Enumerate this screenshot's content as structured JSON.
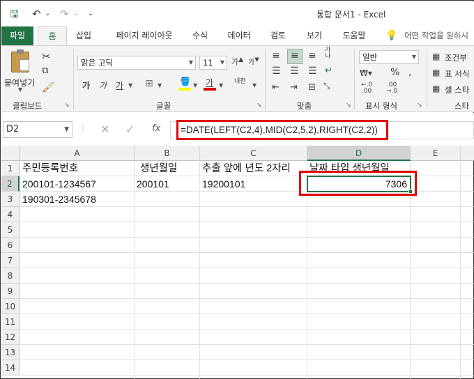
{
  "window": {
    "title": "통합 문서1  -  Excel"
  },
  "qat": {
    "save": "🖫",
    "undo": "↶",
    "redo": "↷",
    "more": "⌄"
  },
  "tabs": [
    "파일",
    "홈",
    "삽입",
    "페이지 레이아웃",
    "수식",
    "데이터",
    "검토",
    "보기",
    "도움말"
  ],
  "tell_me": "어떤 작업을 원하시",
  "ribbon": {
    "paste": "붙여넣기",
    "groups": {
      "clipboard": "클립보드",
      "font": "글꼴",
      "align": "맞춤",
      "number": "표시 형식",
      "styles": "스타"
    },
    "font_name": "맑은 고딕",
    "font_size": "11",
    "number_format": "일반",
    "cond_format": "조건부",
    "table_format": "표 서식",
    "cell_style": "셀 스타",
    "bold": "가",
    "italic": "가",
    "underline": "가",
    "wrap": "내천"
  },
  "namebox": "D2",
  "formula": "=DATE(LEFT(C2,4),MID(C2,5,2),RIGHT(C2,2))",
  "fx": "fx",
  "columns": [
    "A",
    "B",
    "C",
    "D",
    "E"
  ],
  "rows": [
    "1",
    "2",
    "3",
    "4",
    "5",
    "6",
    "7",
    "8",
    "9",
    "10",
    "11",
    "12",
    "13",
    "14"
  ],
  "cells": {
    "A1": "주민등록번호",
    "B1": "생년월일",
    "C1": "추출 앞에 년도 2자리",
    "D1": "날짜 타입 생년월일",
    "A2": "200101-1234567",
    "B2": "200101",
    "C2": "19200101",
    "D2": "7306",
    "A3": "190301-2345678"
  },
  "colors": {
    "excel_green": "#217346",
    "highlight": "#e00000"
  }
}
